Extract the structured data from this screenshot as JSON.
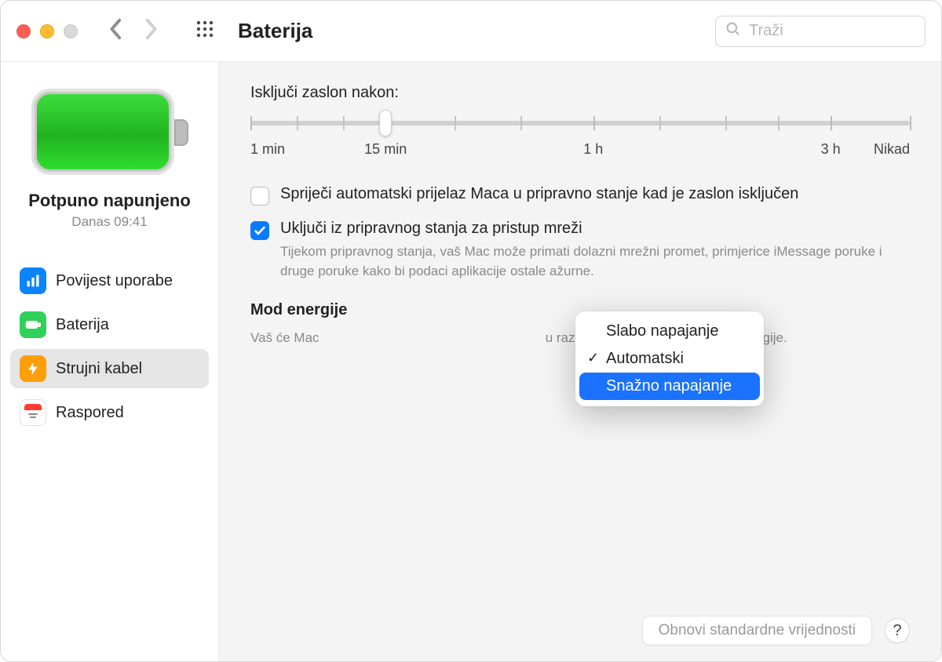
{
  "header": {
    "title": "Baterija",
    "search_placeholder": "Traži"
  },
  "sidebar": {
    "status_title": "Potpuno napunjeno",
    "status_sub": "Danas 09:41",
    "items": [
      {
        "label": "Povijest uporabe",
        "icon": "bars",
        "color": "blue"
      },
      {
        "label": "Baterija",
        "icon": "battery",
        "color": "green"
      },
      {
        "label": "Strujni kabel",
        "icon": "bolt",
        "color": "orange"
      },
      {
        "label": "Raspored",
        "icon": "calendar",
        "color": "white"
      }
    ],
    "selected_index": 2
  },
  "main": {
    "slider_label": "Isključi zaslon nakon:",
    "slider_ticks": {
      "l0": "1 min",
      "l1": "15 min",
      "l2": "1 h",
      "l3": "3 h",
      "l4": "Nikad"
    },
    "slider_value_percent": 20.5,
    "opt1": {
      "checked": false,
      "label": "Spriječi automatski prijelaz Maca u pripravno stanje kad je zaslon isključen"
    },
    "opt2": {
      "checked": true,
      "label": "Uključi iz pripravnog stanja za pristup mreži",
      "help": "Tijekom pripravnog stanja, vaš Mac može primati dolazni mrežni promet, primjerice iMessage poruke i druge poruke kako bi podaci aplikacije ostale ažurne."
    },
    "energy": {
      "label_prefix": "Mod energije",
      "help_prefix": "Vaš će Mac",
      "help_suffix": "u razinu performansi i potrošnje energije.",
      "options": {
        "o0": "Slabo napajanje",
        "o1": "Automatski",
        "o2": "Snažno napajanje"
      },
      "selected_option_index": 1,
      "highlighted_option_index": 2
    },
    "reset_label": "Obnovi standardne vrijednosti",
    "help_label": "?"
  }
}
